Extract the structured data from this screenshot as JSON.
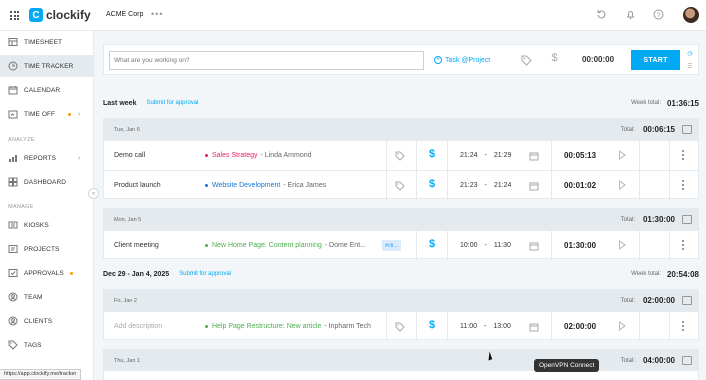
{
  "topbar": {
    "brand": "clockify",
    "workspace": "ACME Corp",
    "more": "•••"
  },
  "sidebar": {
    "items": [
      {
        "label": "TIMESHEET",
        "icon": "timesheet-icon"
      },
      {
        "label": "TIME TRACKER",
        "icon": "clock-icon"
      },
      {
        "label": "CALENDAR",
        "icon": "calendar-icon"
      },
      {
        "label": "TIME OFF",
        "icon": "time-off-icon"
      }
    ],
    "section_analyze": "ANALYZE",
    "analyze_items": [
      {
        "label": "REPORTS",
        "icon": "reports-icon"
      },
      {
        "label": "DASHBOARD",
        "icon": "dashboard-icon"
      }
    ],
    "section_manage": "MANAGE",
    "manage_items": [
      {
        "label": "KIOSKS",
        "icon": "kiosk-icon"
      },
      {
        "label": "PROJECTS",
        "icon": "projects-icon"
      },
      {
        "label": "APPROVALS",
        "icon": "approvals-icon"
      },
      {
        "label": "TEAM",
        "icon": "team-icon"
      },
      {
        "label": "CLIENTS",
        "icon": "clients-icon"
      },
      {
        "label": "TAGS",
        "icon": "tag-icon"
      }
    ],
    "collapse": "«"
  },
  "tracker": {
    "placeholder": "What are you working on?",
    "task_project": "Task @Project",
    "timer": "00:00:00",
    "start_label": "START"
  },
  "weeks": [
    {
      "title": "Last week",
      "submit": "Submit for approval",
      "total_label": "Week total:",
      "total": "01:36:15"
    },
    {
      "title": "Dec 29 - Jan 4, 2025",
      "submit": "Submit for approval",
      "total_label": "Week total:",
      "total": "20:54:08"
    }
  ],
  "groups": [
    {
      "date": "Tue, Jan 6",
      "total_label": "Total:",
      "total": "00:06:15",
      "entries": [
        {
          "desc": "Demo call",
          "project": "Sales Strategy",
          "client": "- Linda Ammond",
          "color": "#e91e63",
          "start": "21:24",
          "sep": "-",
          "end": "21:29",
          "duration": "00:05:13"
        },
        {
          "desc": "Product launch",
          "project": "Website Development",
          "client": "- Erica James",
          "color": "#1976d2",
          "start": "21:23",
          "sep": "-",
          "end": "21:24",
          "duration": "00:01:02"
        }
      ]
    },
    {
      "date": "Mon, Jan 5",
      "total_label": "Total:",
      "total": "01:30:00",
      "entries": [
        {
          "desc": "Client meeting",
          "project": "New Home Page: Content planning",
          "client": "- Dome Ent...",
          "color": "#4caf50",
          "tag": "#cli...",
          "start": "10:00",
          "sep": "-",
          "end": "11:30",
          "duration": "01:30:00"
        }
      ]
    },
    {
      "date": "Fri, Jan 2",
      "total_label": "Total:",
      "total": "02:00:00",
      "entries": [
        {
          "desc": "Add description",
          "project": "Help Page Restructure: New article",
          "client": "- Inpharm Tech",
          "color": "#4caf50",
          "start": "11:00",
          "sep": "-",
          "end": "13:00",
          "duration": "02:00:00"
        }
      ]
    },
    {
      "date": "Thu, Jan 1",
      "total_label": "Total:",
      "total": "04:00:00"
    }
  ],
  "status_url": "https://app.clockify.me/tracker",
  "tooltip": "OpenVPN Connect",
  "colors": {
    "accent": "#03a9f4",
    "sidebar_active": "#e4eaee",
    "group_header": "#e4eaee"
  }
}
